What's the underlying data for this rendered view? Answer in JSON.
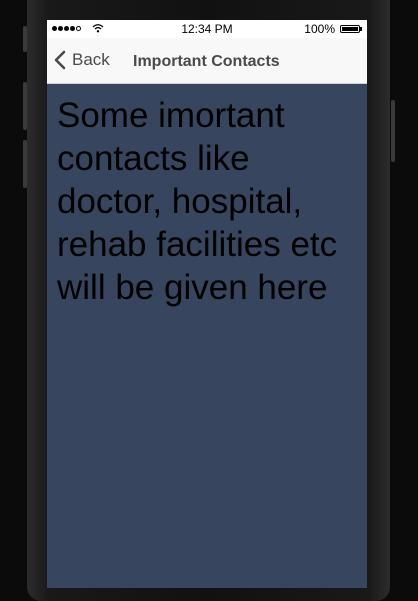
{
  "status_bar": {
    "time": "12:34 PM",
    "battery_percent": "100%",
    "battery_level": 1.0,
    "signal_bars_filled": 4,
    "signal_bars_total": 5
  },
  "nav": {
    "back_label": "Back",
    "title": "Important Contacts"
  },
  "content": {
    "message": "Some imortant contacts like doctor, hospital, rehab facilities etc will be given here"
  },
  "colors": {
    "content_background": "#37455f",
    "nav_background": "#f8f8f8",
    "nav_text": "#4a4a4a"
  },
  "icons": {
    "back": "chevron-left-icon",
    "wifi": "wifi-icon",
    "battery": "battery-icon",
    "signal": "signal-icon"
  }
}
